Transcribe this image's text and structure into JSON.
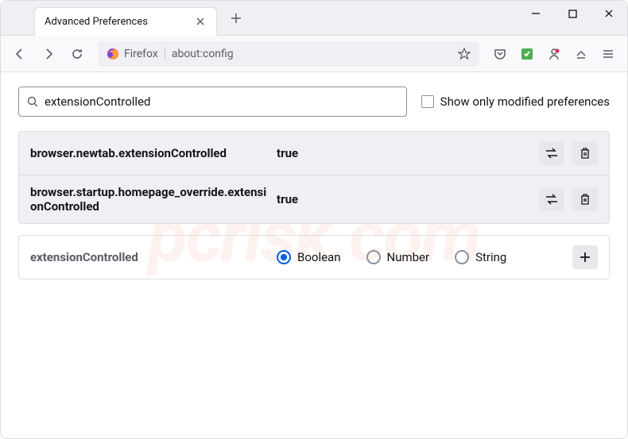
{
  "window": {
    "tab_title": "Advanced Preferences"
  },
  "urlbar": {
    "identity": "Firefox",
    "url": "about:config"
  },
  "search": {
    "value": "extensionControlled",
    "checkbox_label": "Show only modified preferences"
  },
  "prefs": [
    {
      "name": "browser.newtab.extensionControlled",
      "value": "true"
    },
    {
      "name": "browser.startup.homepage_override.extensionControlled",
      "value": "true"
    }
  ],
  "new_pref": {
    "name": "extensionControlled",
    "types": [
      "Boolean",
      "Number",
      "String"
    ],
    "selected": "Boolean"
  },
  "watermark": "pcrisk.com"
}
